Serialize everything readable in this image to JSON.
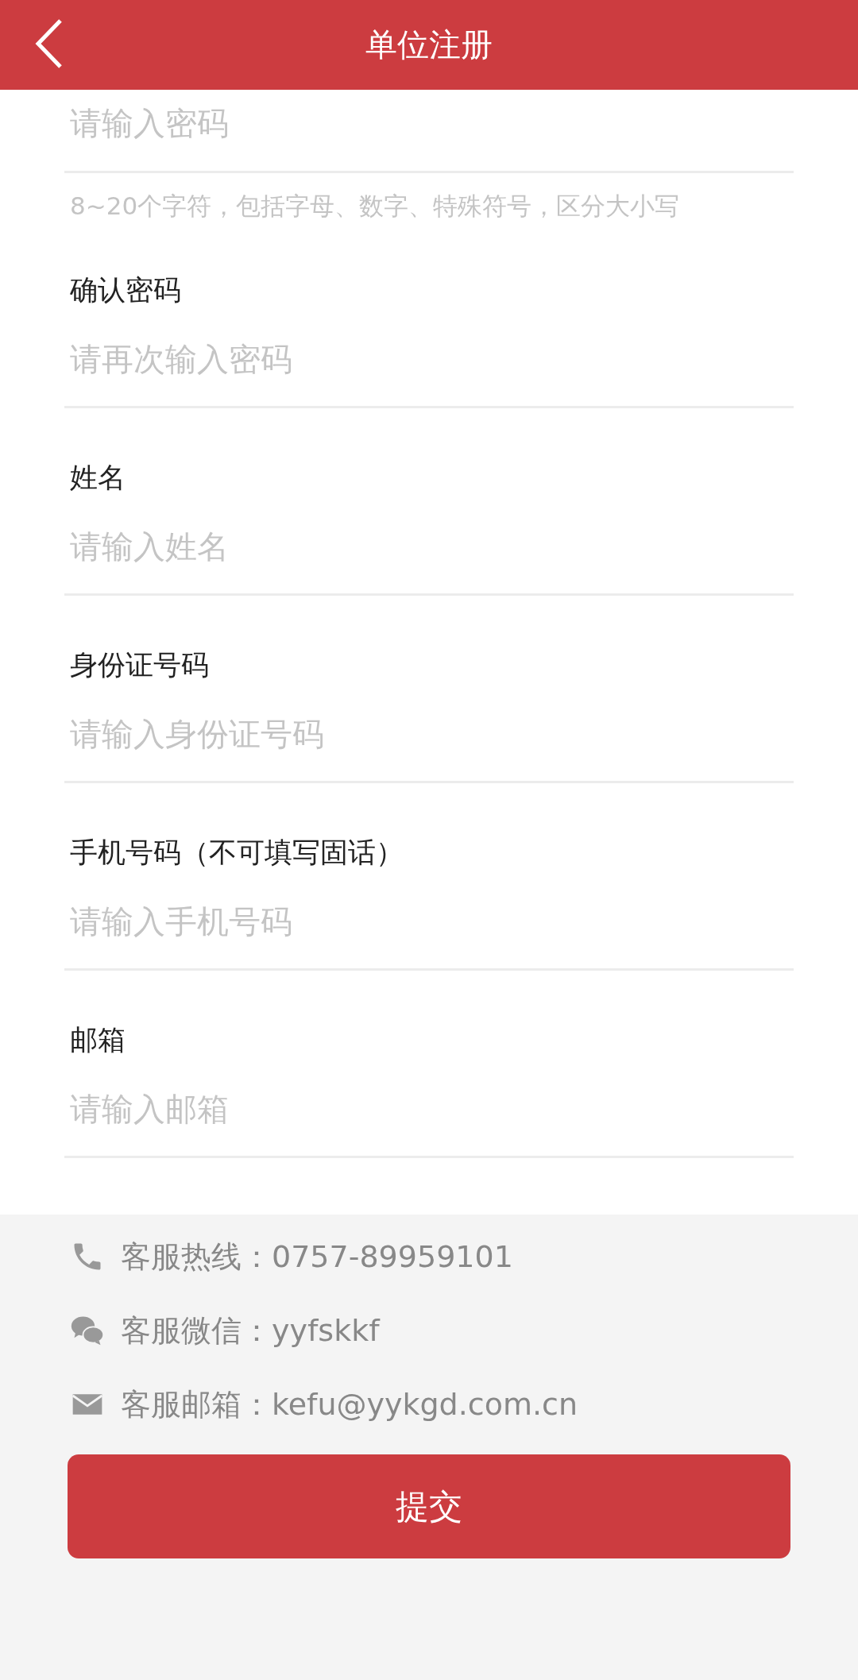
{
  "header": {
    "title": "单位注册"
  },
  "password": {
    "placeholder": "请输入密码",
    "hint": "8~20个字符，包括字母、数字、特殊符号，区分大小写"
  },
  "fields": [
    {
      "label": "确认密码",
      "placeholder": "请再次输入密码"
    },
    {
      "label": "姓名",
      "placeholder": "请输入姓名"
    },
    {
      "label": "身份证号码",
      "placeholder": "请输入身份证号码"
    },
    {
      "label": "手机号码（不可填写固话）",
      "placeholder": "请输入手机号码"
    },
    {
      "label": "邮箱",
      "placeholder": "请输入邮箱"
    }
  ],
  "contacts": [
    {
      "kind": "phone",
      "text": "客服热线：0757-89959101"
    },
    {
      "kind": "wechat",
      "text": "客服微信：yyfskkf"
    },
    {
      "kind": "email",
      "text": "客服邮箱：kefu@yykgd.com.cn"
    }
  ],
  "submit": {
    "label": "提交"
  }
}
